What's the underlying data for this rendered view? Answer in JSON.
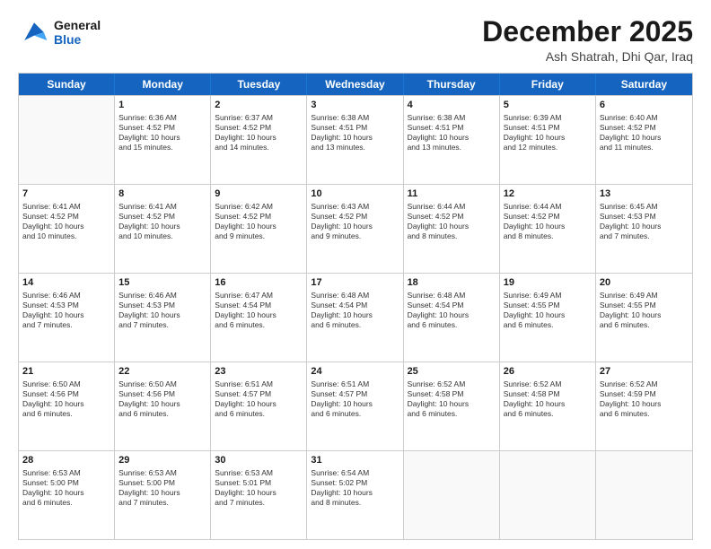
{
  "logo": {
    "line1": "General",
    "line2": "Blue"
  },
  "title": "December 2025",
  "subtitle": "Ash Shatrah, Dhi Qar, Iraq",
  "header_days": [
    "Sunday",
    "Monday",
    "Tuesday",
    "Wednesday",
    "Thursday",
    "Friday",
    "Saturday"
  ],
  "weeks": [
    [
      {
        "day": "",
        "info": ""
      },
      {
        "day": "1",
        "info": "Sunrise: 6:36 AM\nSunset: 4:52 PM\nDaylight: 10 hours\nand 15 minutes."
      },
      {
        "day": "2",
        "info": "Sunrise: 6:37 AM\nSunset: 4:52 PM\nDaylight: 10 hours\nand 14 minutes."
      },
      {
        "day": "3",
        "info": "Sunrise: 6:38 AM\nSunset: 4:51 PM\nDaylight: 10 hours\nand 13 minutes."
      },
      {
        "day": "4",
        "info": "Sunrise: 6:38 AM\nSunset: 4:51 PM\nDaylight: 10 hours\nand 13 minutes."
      },
      {
        "day": "5",
        "info": "Sunrise: 6:39 AM\nSunset: 4:51 PM\nDaylight: 10 hours\nand 12 minutes."
      },
      {
        "day": "6",
        "info": "Sunrise: 6:40 AM\nSunset: 4:52 PM\nDaylight: 10 hours\nand 11 minutes."
      }
    ],
    [
      {
        "day": "7",
        "info": "Sunrise: 6:41 AM\nSunset: 4:52 PM\nDaylight: 10 hours\nand 10 minutes."
      },
      {
        "day": "8",
        "info": "Sunrise: 6:41 AM\nSunset: 4:52 PM\nDaylight: 10 hours\nand 10 minutes."
      },
      {
        "day": "9",
        "info": "Sunrise: 6:42 AM\nSunset: 4:52 PM\nDaylight: 10 hours\nand 9 minutes."
      },
      {
        "day": "10",
        "info": "Sunrise: 6:43 AM\nSunset: 4:52 PM\nDaylight: 10 hours\nand 9 minutes."
      },
      {
        "day": "11",
        "info": "Sunrise: 6:44 AM\nSunset: 4:52 PM\nDaylight: 10 hours\nand 8 minutes."
      },
      {
        "day": "12",
        "info": "Sunrise: 6:44 AM\nSunset: 4:52 PM\nDaylight: 10 hours\nand 8 minutes."
      },
      {
        "day": "13",
        "info": "Sunrise: 6:45 AM\nSunset: 4:53 PM\nDaylight: 10 hours\nand 7 minutes."
      }
    ],
    [
      {
        "day": "14",
        "info": "Sunrise: 6:46 AM\nSunset: 4:53 PM\nDaylight: 10 hours\nand 7 minutes."
      },
      {
        "day": "15",
        "info": "Sunrise: 6:46 AM\nSunset: 4:53 PM\nDaylight: 10 hours\nand 7 minutes."
      },
      {
        "day": "16",
        "info": "Sunrise: 6:47 AM\nSunset: 4:54 PM\nDaylight: 10 hours\nand 6 minutes."
      },
      {
        "day": "17",
        "info": "Sunrise: 6:48 AM\nSunset: 4:54 PM\nDaylight: 10 hours\nand 6 minutes."
      },
      {
        "day": "18",
        "info": "Sunrise: 6:48 AM\nSunset: 4:54 PM\nDaylight: 10 hours\nand 6 minutes."
      },
      {
        "day": "19",
        "info": "Sunrise: 6:49 AM\nSunset: 4:55 PM\nDaylight: 10 hours\nand 6 minutes."
      },
      {
        "day": "20",
        "info": "Sunrise: 6:49 AM\nSunset: 4:55 PM\nDaylight: 10 hours\nand 6 minutes."
      }
    ],
    [
      {
        "day": "21",
        "info": "Sunrise: 6:50 AM\nSunset: 4:56 PM\nDaylight: 10 hours\nand 6 minutes."
      },
      {
        "day": "22",
        "info": "Sunrise: 6:50 AM\nSunset: 4:56 PM\nDaylight: 10 hours\nand 6 minutes."
      },
      {
        "day": "23",
        "info": "Sunrise: 6:51 AM\nSunset: 4:57 PM\nDaylight: 10 hours\nand 6 minutes."
      },
      {
        "day": "24",
        "info": "Sunrise: 6:51 AM\nSunset: 4:57 PM\nDaylight: 10 hours\nand 6 minutes."
      },
      {
        "day": "25",
        "info": "Sunrise: 6:52 AM\nSunset: 4:58 PM\nDaylight: 10 hours\nand 6 minutes."
      },
      {
        "day": "26",
        "info": "Sunrise: 6:52 AM\nSunset: 4:58 PM\nDaylight: 10 hours\nand 6 minutes."
      },
      {
        "day": "27",
        "info": "Sunrise: 6:52 AM\nSunset: 4:59 PM\nDaylight: 10 hours\nand 6 minutes."
      }
    ],
    [
      {
        "day": "28",
        "info": "Sunrise: 6:53 AM\nSunset: 5:00 PM\nDaylight: 10 hours\nand 6 minutes."
      },
      {
        "day": "29",
        "info": "Sunrise: 6:53 AM\nSunset: 5:00 PM\nDaylight: 10 hours\nand 7 minutes."
      },
      {
        "day": "30",
        "info": "Sunrise: 6:53 AM\nSunset: 5:01 PM\nDaylight: 10 hours\nand 7 minutes."
      },
      {
        "day": "31",
        "info": "Sunrise: 6:54 AM\nSunset: 5:02 PM\nDaylight: 10 hours\nand 8 minutes."
      },
      {
        "day": "",
        "info": ""
      },
      {
        "day": "",
        "info": ""
      },
      {
        "day": "",
        "info": ""
      }
    ]
  ]
}
